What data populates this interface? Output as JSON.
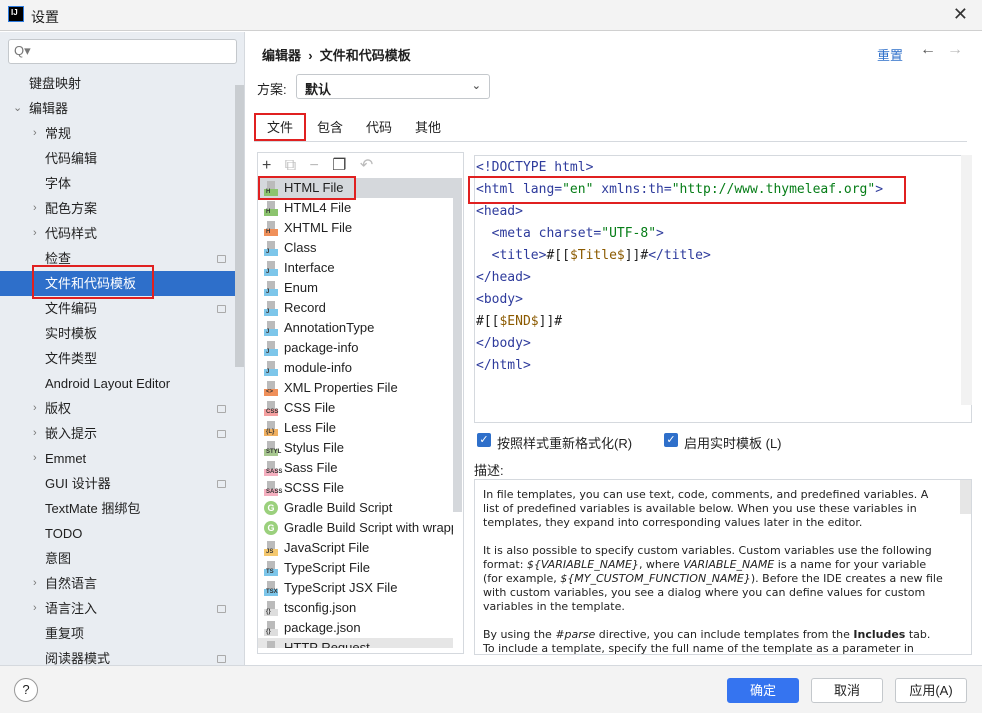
{
  "window": {
    "title": "设置",
    "close_icon": "✕"
  },
  "search": {
    "placeholder": "",
    "icon": "Q▾"
  },
  "sidebar": {
    "items": [
      {
        "label": "键盘映射",
        "level": 0,
        "arrow": "",
        "icon": false
      },
      {
        "label": "编辑器",
        "level": 0,
        "arrow": "⌄",
        "icon": false
      },
      {
        "label": "常规",
        "level": 1,
        "arrow": "›",
        "icon": false
      },
      {
        "label": "代码编辑",
        "level": 1,
        "arrow": "",
        "icon": false
      },
      {
        "label": "字体",
        "level": 1,
        "arrow": "",
        "icon": false
      },
      {
        "label": "配色方案",
        "level": 1,
        "arrow": "›",
        "icon": false
      },
      {
        "label": "代码样式",
        "level": 1,
        "arrow": "›",
        "icon": false
      },
      {
        "label": "检查",
        "level": 1,
        "arrow": "",
        "icon": true
      },
      {
        "label": "文件和代码模板",
        "level": 1,
        "arrow": "",
        "icon": false,
        "selected": true
      },
      {
        "label": "文件编码",
        "level": 1,
        "arrow": "",
        "icon": true
      },
      {
        "label": "实时模板",
        "level": 1,
        "arrow": "",
        "icon": false
      },
      {
        "label": "文件类型",
        "level": 1,
        "arrow": "",
        "icon": false
      },
      {
        "label": "Android Layout Editor",
        "level": 1,
        "arrow": "",
        "icon": false
      },
      {
        "label": "版权",
        "level": 1,
        "arrow": "›",
        "icon": true
      },
      {
        "label": "嵌入提示",
        "level": 1,
        "arrow": "›",
        "icon": true
      },
      {
        "label": "Emmet",
        "level": 1,
        "arrow": "›",
        "icon": false
      },
      {
        "label": "GUI 设计器",
        "level": 1,
        "arrow": "",
        "icon": true
      },
      {
        "label": "TextMate 捆绑包",
        "level": 1,
        "arrow": "",
        "icon": false
      },
      {
        "label": "TODO",
        "level": 1,
        "arrow": "",
        "icon": false
      },
      {
        "label": "意图",
        "level": 1,
        "arrow": "",
        "icon": false
      },
      {
        "label": "自然语言",
        "level": 1,
        "arrow": "›",
        "icon": false
      },
      {
        "label": "语言注入",
        "level": 1,
        "arrow": "›",
        "icon": true
      },
      {
        "label": "重复项",
        "level": 1,
        "arrow": "",
        "icon": false
      },
      {
        "label": "阅读器模式",
        "level": 1,
        "arrow": "",
        "icon": true
      }
    ]
  },
  "header": {
    "breadcrumb": "编辑器  ›  文件和代码模板",
    "reset": "重置",
    "back": "←",
    "forward": "→"
  },
  "scheme": {
    "label": "方案:",
    "value": "默认"
  },
  "tabs": [
    {
      "label": "文件",
      "active": true
    },
    {
      "label": "包含"
    },
    {
      "label": "代码"
    },
    {
      "label": "其他"
    }
  ],
  "list_toolbar": [
    "+",
    "⧉",
    "−",
    "❐",
    "↶"
  ],
  "files": [
    {
      "label": "HTML File",
      "badge": "H",
      "color": "#8cc46e",
      "selected": true
    },
    {
      "label": "HTML4 File",
      "badge": "H",
      "color": "#8cc46e"
    },
    {
      "label": "XHTML File",
      "badge": "H",
      "color": "#f0905a"
    },
    {
      "label": "Class",
      "badge": "J",
      "color": "#7dc6ea"
    },
    {
      "label": "Interface",
      "badge": "J",
      "color": "#7dc6ea"
    },
    {
      "label": "Enum",
      "badge": "J",
      "color": "#7dc6ea"
    },
    {
      "label": "Record",
      "badge": "J",
      "color": "#7dc6ea"
    },
    {
      "label": "AnnotationType",
      "badge": "J",
      "color": "#7dc6ea"
    },
    {
      "label": "package-info",
      "badge": "J",
      "color": "#7dc6ea"
    },
    {
      "label": "module-info",
      "badge": "J",
      "color": "#7dc6ea"
    },
    {
      "label": "XML Properties File",
      "badge": "<>",
      "color": "#f0905a"
    },
    {
      "label": "CSS File",
      "badge": "CSS",
      "color": "#f5a0a0"
    },
    {
      "label": "Less File",
      "badge": "{L}",
      "color": "#f0b060"
    },
    {
      "label": "Stylus File",
      "badge": "STYL",
      "color": "#a8c890"
    },
    {
      "label": "Sass File",
      "badge": "SASS",
      "color": "#f5b0c0"
    },
    {
      "label": "SCSS File",
      "badge": "SASS",
      "color": "#f5b0c0"
    },
    {
      "label": "Gradle Build Script",
      "badge": "G",
      "color": "#9bd07d",
      "round": true
    },
    {
      "label": "Gradle Build Script with wrapper",
      "badge": "G",
      "color": "#9bd07d",
      "round": true
    },
    {
      "label": "JavaScript File",
      "badge": "JS",
      "color": "#f5c86e"
    },
    {
      "label": "TypeScript File",
      "badge": "TS",
      "color": "#7dc6ea"
    },
    {
      "label": "TypeScript JSX File",
      "badge": "TSX",
      "color": "#7dc6ea"
    },
    {
      "label": "tsconfig.json",
      "badge": "{}",
      "color": "#dddddd"
    },
    {
      "label": "package.json",
      "badge": "{}",
      "color": "#dddddd"
    },
    {
      "label": "HTTP Request",
      "badge": "API",
      "color": "#bcc8d8"
    }
  ],
  "code_lines": [
    [
      [
        "t",
        "<!DOCTYPE "
      ],
      [
        "t",
        "html"
      ],
      [
        "t",
        ">"
      ]
    ],
    [
      [
        "t",
        "<html "
      ],
      [
        "t",
        "lang="
      ],
      [
        "v",
        "\"en\""
      ],
      [
        "x",
        " "
      ],
      [
        "t",
        "xmlns:th="
      ],
      [
        "v",
        "\"http://www.thymeleaf.org\""
      ],
      [
        "t",
        ">"
      ]
    ],
    [
      [
        "t",
        "<head>"
      ]
    ],
    [
      [
        "x",
        "  "
      ],
      [
        "t",
        "<meta "
      ],
      [
        "t",
        "charset="
      ],
      [
        "v",
        "\"UTF-8\""
      ],
      [
        "t",
        ">"
      ]
    ],
    [
      [
        "x",
        "  "
      ],
      [
        "t",
        "<title>"
      ],
      [
        "x",
        "#[["
      ],
      [
        "p",
        "$Title$"
      ],
      [
        "x",
        "]]#"
      ],
      [
        "t",
        "</title>"
      ]
    ],
    [
      [
        "t",
        "</head>"
      ]
    ],
    [
      [
        "t",
        "<body>"
      ]
    ],
    [
      [
        "x",
        "#[["
      ],
      [
        "p",
        "$END$"
      ],
      [
        "x",
        "]]#"
      ]
    ],
    [
      [
        "t",
        "</body>"
      ]
    ],
    [
      [
        "t",
        "</html>"
      ]
    ]
  ],
  "options": {
    "reformat": "按照样式重新格式化(R)",
    "live_templates": "启用实时模板 (L)",
    "reformat_checked": true,
    "live_checked": true
  },
  "description": {
    "label": "描述:",
    "paragraphs": [
      "In file templates, you can use text, code, comments, and predefined variables. A list of predefined variables is available below. When you use these variables in templates, they expand into corresponding values later in the editor.",
      "It is also possible to specify custom variables. Custom variables use the following format: <i>${VARIABLE_NAME}</i>, where <i>VARIABLE_NAME</i> is a name for your variable (for example, <i>${MY_CUSTOM_FUNCTION_NAME}</i>). Before the IDE creates a new file with custom variables, you see a dialog where you can define values for custom variables in the template.",
      "By using the <i>#parse</i> directive, you can include templates from the <b>Includes</b> tab. To include a template, specify the full name of the template as a parameter in"
    ]
  },
  "footer": {
    "help": "?",
    "ok": "确定",
    "cancel": "取消",
    "apply": "应用(A)"
  }
}
